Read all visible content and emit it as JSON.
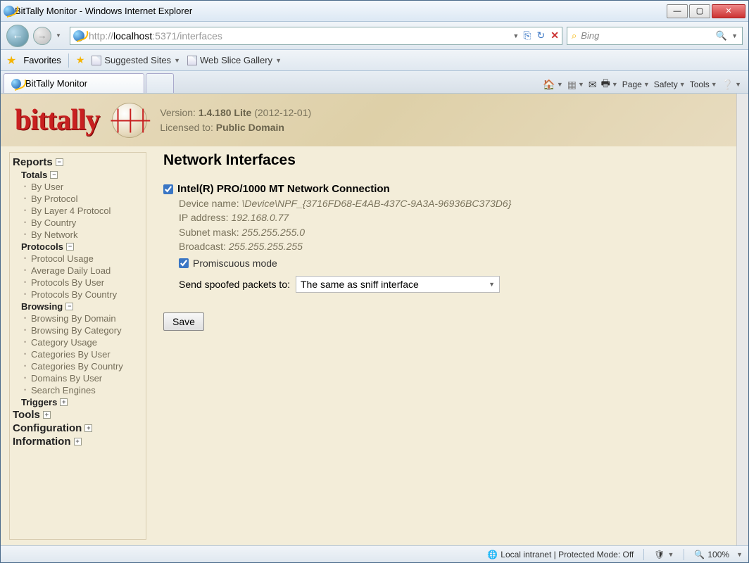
{
  "window": {
    "title": "BitTally Monitor - Windows Internet Explorer"
  },
  "address": {
    "scheme": "http://",
    "host": "localhost",
    "rest": ":5371/interfaces"
  },
  "search": {
    "placeholder": "Bing"
  },
  "favbar": {
    "favorites": "Favorites",
    "suggested": "Suggested Sites",
    "webslice": "Web Slice Gallery"
  },
  "tab": {
    "label": "BitTally Monitor"
  },
  "toolbar": {
    "page": "Page",
    "safety": "Safety",
    "tools": "Tools"
  },
  "header": {
    "logo": "bittally",
    "version_label": "Version:",
    "version_value": "1.4.180 Lite",
    "version_date": "(2012-12-01)",
    "licensed_label": "Licensed to:",
    "licensed_value": "Public Domain"
  },
  "sidebar": {
    "reports": "Reports",
    "totals": "Totals",
    "totals_items": [
      "By User",
      "By Protocol",
      "By Layer 4 Protocol",
      "By Country",
      "By Network"
    ],
    "protocols": "Protocols",
    "protocols_items": [
      "Protocol Usage",
      "Average Daily Load",
      "Protocols By User",
      "Protocols By Country"
    ],
    "browsing": "Browsing",
    "browsing_items": [
      "Browsing By Domain",
      "Browsing By Category",
      "Category Usage",
      "Categories By User",
      "Categories By Country",
      "Domains By User",
      "Search Engines"
    ],
    "triggers": "Triggers",
    "tools": "Tools",
    "configuration": "Configuration",
    "information": "Information"
  },
  "main": {
    "heading": "Network Interfaces",
    "iface": {
      "name": "Intel(R) PRO/1000 MT Network Connection",
      "device_label": "Device name:",
      "device_value": "\\Device\\NPF_{3716FD68-E4AB-437C-9A3A-96936BC373D6}",
      "ip_label": "IP address:",
      "ip_value": "192.168.0.77",
      "mask_label": "Subnet mask:",
      "mask_value": "255.255.255.0",
      "bcast_label": "Broadcast:",
      "bcast_value": "255.255.255.255",
      "promisc": "Promiscuous mode",
      "spoof_label": "Send spoofed packets to:",
      "spoof_value": "The same as sniff interface"
    },
    "save": "Save"
  },
  "status": {
    "zone": "Local intranet | Protected Mode: Off",
    "zoom": "100%"
  }
}
